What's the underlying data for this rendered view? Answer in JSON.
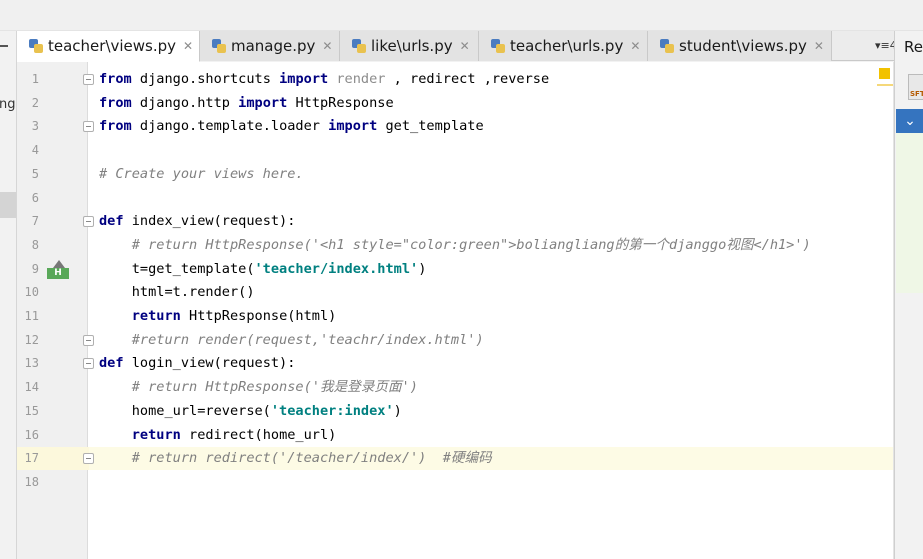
{
  "tabs": [
    {
      "label": "teacher\\views.py",
      "active": true
    },
    {
      "label": "manage.py",
      "active": false
    },
    {
      "label": "like\\urls.py",
      "active": false
    },
    {
      "label": "teacher\\urls.py",
      "active": false
    },
    {
      "label": "student\\views.py",
      "active": false
    }
  ],
  "tab_overflow": "▾≡4",
  "left_panel": {
    "stub_text": "ngo"
  },
  "right_panel": {
    "title": "Re",
    "sftp_label": "SFT"
  },
  "gutter": {
    "bookmark_label": "H",
    "current_line": 17
  },
  "lines": [
    {
      "num": "1",
      "fold": true,
      "tokens": [
        {
          "t": "kw",
          "v": "from"
        },
        {
          "t": "",
          "v": " django.shortcuts "
        },
        {
          "t": "kw",
          "v": "import"
        },
        {
          "t": "cm-plain",
          "v": " render"
        },
        {
          "t": "",
          "v": " , redirect ,reverse"
        }
      ]
    },
    {
      "num": "2",
      "fold": false,
      "tokens": [
        {
          "t": "kw",
          "v": "from"
        },
        {
          "t": "",
          "v": " django.http "
        },
        {
          "t": "kw",
          "v": "import"
        },
        {
          "t": "",
          "v": " HttpResponse"
        }
      ]
    },
    {
      "num": "3",
      "fold": true,
      "tokens": [
        {
          "t": "kw",
          "v": "from"
        },
        {
          "t": "",
          "v": " django.template.loader "
        },
        {
          "t": "kw",
          "v": "import"
        },
        {
          "t": "",
          "v": " get_template"
        }
      ]
    },
    {
      "num": "4",
      "fold": false,
      "tokens": []
    },
    {
      "num": "5",
      "fold": false,
      "tokens": [
        {
          "t": "cm",
          "v": "# Create your views here."
        }
      ]
    },
    {
      "num": "6",
      "fold": false,
      "tokens": []
    },
    {
      "num": "7",
      "fold": true,
      "tokens": [
        {
          "t": "kw",
          "v": "def"
        },
        {
          "t": "",
          "v": " index_view(request):"
        }
      ]
    },
    {
      "num": "8",
      "fold": false,
      "tokens": [
        {
          "t": "cm",
          "v": "    # return HttpResponse('<h1 style=\"color:green\">boliangliang的第一个djanggo视图</h1>')"
        }
      ]
    },
    {
      "num": "9",
      "fold": false,
      "bookmark": true,
      "tokens": [
        {
          "t": "",
          "v": "    t=get_template("
        },
        {
          "t": "str",
          "v": "'teacher/index.html'"
        },
        {
          "t": "",
          "v": ")"
        }
      ]
    },
    {
      "num": "10",
      "fold": false,
      "tokens": [
        {
          "t": "",
          "v": "    html=t.render()"
        }
      ]
    },
    {
      "num": "11",
      "fold": false,
      "tokens": [
        {
          "t": "",
          "v": "    "
        },
        {
          "t": "kw",
          "v": "return"
        },
        {
          "t": "",
          "v": " HttpResponse(html)"
        }
      ]
    },
    {
      "num": "12",
      "fold": true,
      "tokens": [
        {
          "t": "cm",
          "v": "    #return render(request,'teachr/index.html')"
        }
      ]
    },
    {
      "num": "13",
      "fold": true,
      "tokens": [
        {
          "t": "kw",
          "v": "def"
        },
        {
          "t": "",
          "v": " login_view(request):"
        }
      ]
    },
    {
      "num": "14",
      "fold": false,
      "tokens": [
        {
          "t": "cm",
          "v": "    # return HttpResponse('我是登录页面')"
        }
      ]
    },
    {
      "num": "15",
      "fold": false,
      "tokens": [
        {
          "t": "",
          "v": "    home_url=reverse("
        },
        {
          "t": "str",
          "v": "'teacher:index'"
        },
        {
          "t": "",
          "v": ")"
        }
      ]
    },
    {
      "num": "16",
      "fold": false,
      "tokens": [
        {
          "t": "",
          "v": "    "
        },
        {
          "t": "kw",
          "v": "return"
        },
        {
          "t": "",
          "v": " redirect(home_url)"
        }
      ]
    },
    {
      "num": "17",
      "fold": true,
      "tokens": [
        {
          "t": "cm",
          "v": "    # return redirect('/teacher/index/')  #硬编码"
        }
      ]
    },
    {
      "num": "18",
      "fold": false,
      "tokens": []
    }
  ],
  "colors": {
    "keyword": "#000080",
    "string": "#008080",
    "comment": "#808080",
    "current_line": "#fdfbe5",
    "selection_blue": "#3574bf"
  }
}
